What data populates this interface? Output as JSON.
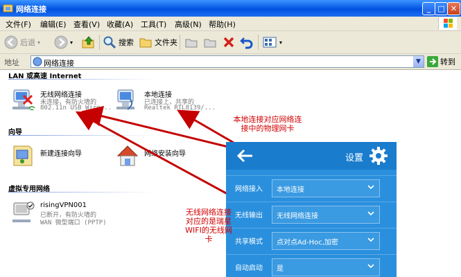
{
  "window": {
    "title": "网络连接"
  },
  "menu": [
    "文件(F)",
    "编辑(E)",
    "查看(V)",
    "收藏(A)",
    "工具(T)",
    "高级(N)",
    "帮助(H)"
  ],
  "toolbar": {
    "back": "后退",
    "search": "搜索",
    "folders": "文件夹"
  },
  "address": {
    "label": "地址",
    "value": "网络连接",
    "go": "转到"
  },
  "groups": {
    "lan": "LAN 或高速 Internet",
    "wizard": "向导",
    "vpn": "虚拟专用网络"
  },
  "items": {
    "wireless": {
      "name": "无线网络连接",
      "line1": "未连接，有防火墙的",
      "line2": "802.11n USB Wire..."
    },
    "local": {
      "name": "本地连接",
      "line1": "已连接上，共享的",
      "line2": "Realtek RTL8139/..."
    },
    "new_wizard": {
      "name": "新建连接向导"
    },
    "home_wizard": {
      "name": "网络安装向导"
    },
    "vpn": {
      "name": "risingVPN001",
      "line1": "已断开，有防火墙的",
      "line2": "WAN 微型端口 (PPTP)"
    }
  },
  "annotations": {
    "local": "本地连接对应网络连接中的物理网卡",
    "wireless": "无线网络连接对应的是瑞星WIFI的无线网卡"
  },
  "settings": {
    "title": "设置",
    "rows": [
      {
        "label": "网络接入",
        "value": "本地连接"
      },
      {
        "label": "无线输出",
        "value": "无线网络连接"
      },
      {
        "label": "共享模式",
        "value": "点对点Ad-Hoc,加密"
      },
      {
        "label": "自动启动",
        "value": "是"
      }
    ]
  },
  "colors": {
    "panel": "#2a90de",
    "panel_header": "#1a7ccd",
    "annotation": "#d00000",
    "titlebar": "#0a5ee8"
  }
}
